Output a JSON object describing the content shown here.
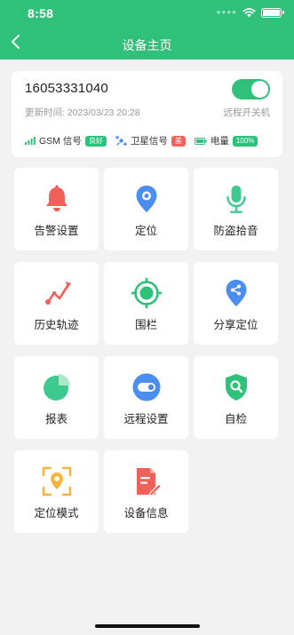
{
  "status": {
    "time": "8:58"
  },
  "header": {
    "title": "设备主页"
  },
  "device": {
    "number": "16053331040",
    "updated": "更新时间: 2023/03/23 20:28",
    "toggle_label": "远程开关机",
    "power_on": true,
    "signals": {
      "gsm_label": "GSM  信号",
      "gsm_badge": "良好",
      "sat_label": "卫星信号",
      "sat_badge": "差",
      "battery_label": "电量",
      "battery_badge": "100%"
    }
  },
  "menu": [
    {
      "label": "告警设置",
      "icon": "bell-icon"
    },
    {
      "label": "定位",
      "icon": "location-pin-icon"
    },
    {
      "label": "防盗拾音",
      "icon": "microphone-icon"
    },
    {
      "label": "历史轨迹",
      "icon": "route-icon"
    },
    {
      "label": "围栏",
      "icon": "fence-target-icon"
    },
    {
      "label": "分享定位",
      "icon": "share-location-icon"
    },
    {
      "label": "报表",
      "icon": "pie-chart-icon"
    },
    {
      "label": "远程设置",
      "icon": "remote-toggle-icon"
    },
    {
      "label": "自检",
      "icon": "shield-search-icon"
    },
    {
      "label": "定位模式",
      "icon": "location-mode-icon"
    },
    {
      "label": "设备信息",
      "icon": "device-info-icon"
    }
  ],
  "colors": {
    "primary": "#2fc07a",
    "danger": "#f2605a",
    "blue": "#4a8ef0",
    "yellow": "#f5b53f"
  }
}
